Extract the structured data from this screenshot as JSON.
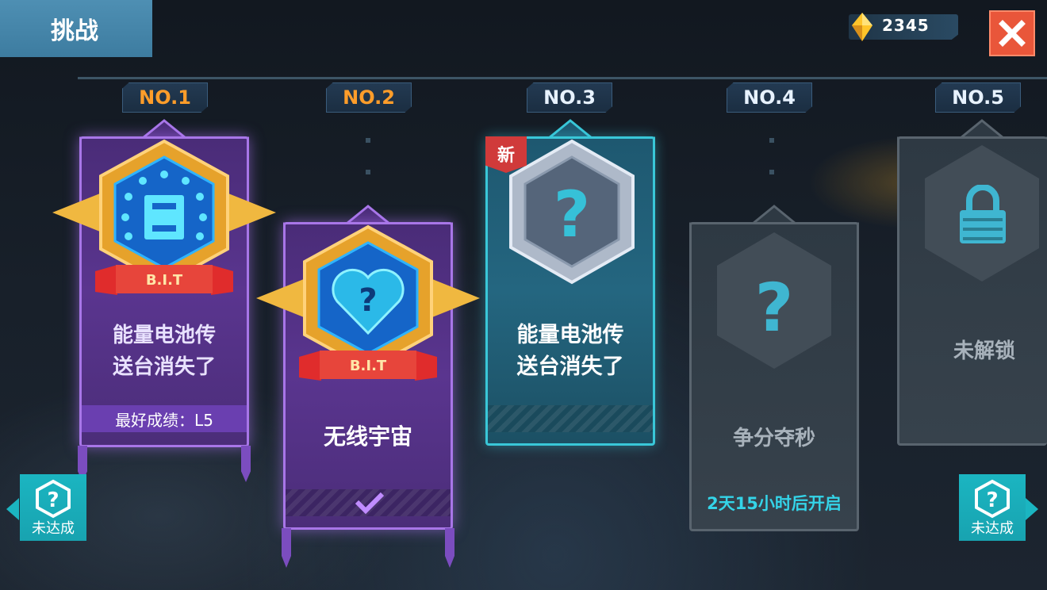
{
  "header": {
    "title": "挑战",
    "gem_count": "2345"
  },
  "levels": [
    {
      "tag": "NO.1",
      "title_line1": "能量电池传",
      "title_line2": "送台消失了",
      "best_score": "最好成绩：L5",
      "badge": "B.I.T"
    },
    {
      "tag": "NO.2",
      "title": "无线宇宙",
      "badge": "B.I.T"
    },
    {
      "tag": "NO.3",
      "title_line1": "能量电池传",
      "title_line2": "送台消失了",
      "new_label": "新"
    },
    {
      "tag": "NO.4",
      "title": "争分夺秒",
      "countdown": "2天15小时后开启"
    },
    {
      "tag": "NO.5",
      "title": "未解锁"
    }
  ],
  "side_buttons": {
    "left_label": "未达成",
    "right_label": "未达成"
  },
  "colors": {
    "accent_orange": "#ff9d2a",
    "teal": "#39c7d8",
    "purple": "#a876e8",
    "close_red": "#e9563a"
  }
}
